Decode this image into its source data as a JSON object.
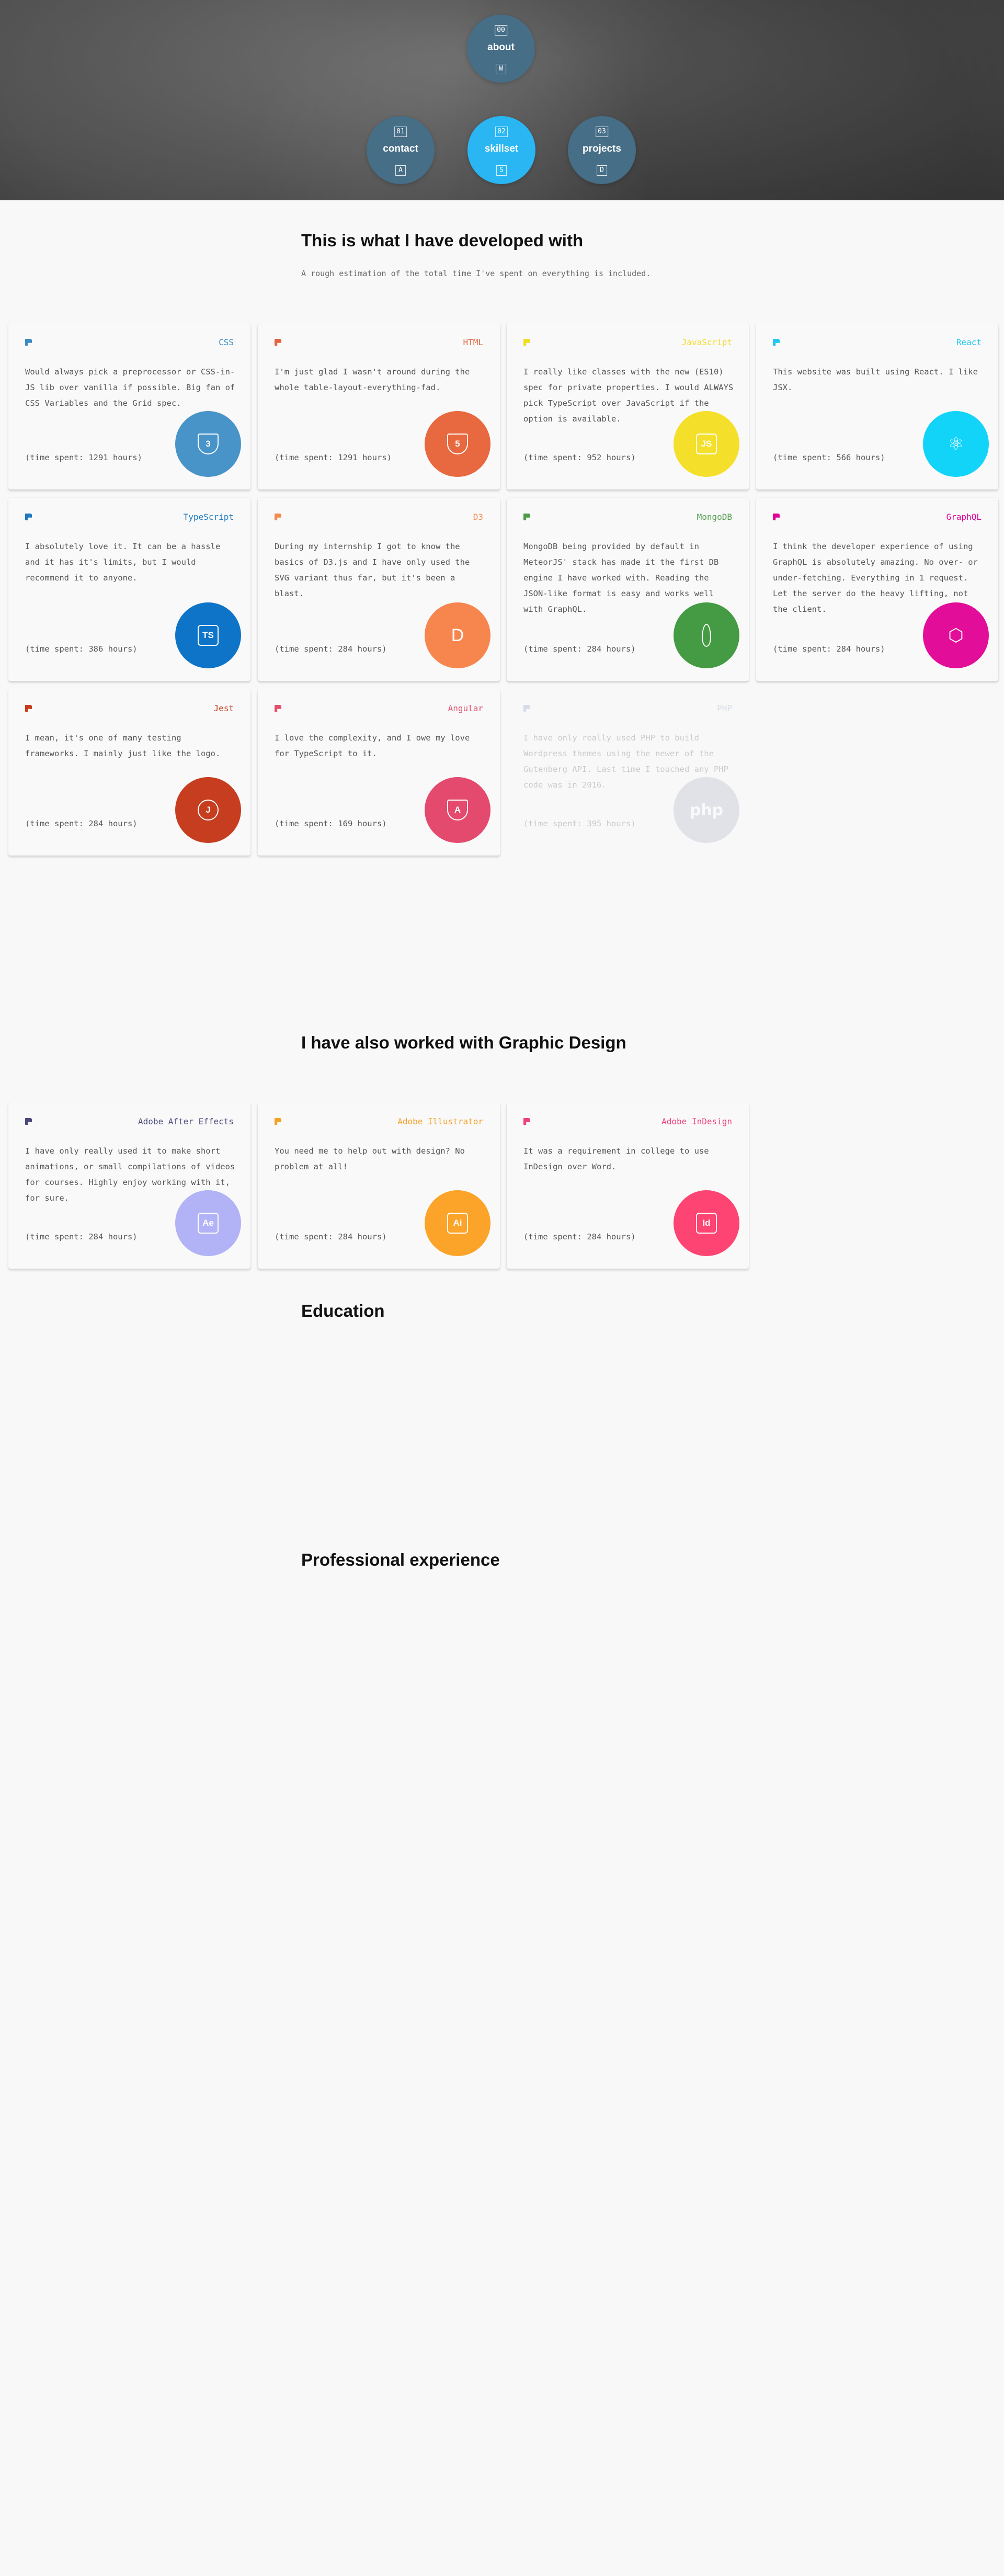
{
  "nav": [
    {
      "num": "00",
      "label": "about",
      "key": "W",
      "active": false
    },
    {
      "num": "01",
      "label": "contact",
      "key": "A",
      "active": false
    },
    {
      "num": "02",
      "label": "skillset",
      "key": "S",
      "active": true
    },
    {
      "num": "03",
      "label": "projects",
      "key": "D",
      "active": false
    }
  ],
  "dev": {
    "title": "This is what I have developed with",
    "subtitle": "A rough estimation of the total time I've spent on everything is included.",
    "cards": [
      {
        "name": "CSS",
        "color": "#3b8cc4",
        "bg": "#4893c8",
        "icon": "css-shield-icon",
        "glyph": "3",
        "shape": "shield",
        "desc": "Would always pick a preprocessor or CSS-in-JS lib over vanilla if possible. Big fan of CSS Variables and the Grid spec.",
        "time": "(time spent: 1291 hours)"
      },
      {
        "name": "HTML",
        "color": "#e4633e",
        "bg": "#e8683f",
        "icon": "html-shield-icon",
        "glyph": "5",
        "shape": "shield",
        "desc": "I'm just glad I wasn't around during the whole table-layout-everything-fad.",
        "time": "(time spent: 1291 hours)"
      },
      {
        "name": "JavaScript",
        "color": "#f1dc27",
        "bg": "#f4e02b",
        "icon": "js-square-icon",
        "glyph": "JS",
        "shape": "square",
        "desc": "I really like classes with the new (ES10) spec for private properties. I would ALWAYS pick TypeScript over JavaScript if the option is available.",
        "time": "(time spent: 952 hours)"
      },
      {
        "name": "React",
        "color": "#1fc8f0",
        "bg": "#12d3f8",
        "icon": "react-atom-icon",
        "glyph": "⚛",
        "shape": "plain",
        "desc": "This website was built using React. I like JSX.",
        "time": "(time spent: 566 hours)"
      },
      {
        "name": "TypeScript",
        "color": "#1f7ac2",
        "bg": "#0d74c8",
        "icon": "ts-square-icon",
        "glyph": "TS",
        "shape": "square",
        "desc": "I absolutely love it. It can be a hassle and it has it's limits, but I would recommend it to anyone.",
        "time": "(time spent: 386 hours)"
      },
      {
        "name": "D3",
        "color": "#f28b4f",
        "bg": "#f7864e",
        "icon": "d3-icon",
        "glyph": "D",
        "shape": "plain",
        "desc": "During my internship I got to know the basics of D3.js and I have only used the SVG variant thus far, but it's been a blast.",
        "time": "(time spent: 284 hours)"
      },
      {
        "name": "MongoDB",
        "color": "#4d9b49",
        "bg": "#459b43",
        "icon": "mongodb-leaf-icon",
        "glyph": "",
        "shape": "leaf",
        "desc": "MongoDB being provided by default in MeteorJS' stack has made it the first DB engine I have worked with. Reading the JSON-like format is easy and works well with GraphQL.",
        "time": "(time spent: 284 hours)"
      },
      {
        "name": "GraphQL",
        "color": "#e10098",
        "bg": "#e20d98",
        "icon": "graphql-icon",
        "glyph": "⬡",
        "shape": "plain",
        "desc": "I think the developer experience of using GraphQL is absolutely amazing. No over- or under-fetching. Everything in 1 request. Let the server do the heavy lifting, not the client.",
        "time": "(time spent: 284 hours)"
      },
      {
        "name": "Jest",
        "color": "#c63d1b",
        "bg": "#c63d1f",
        "icon": "jest-icon",
        "glyph": "J",
        "shape": "round",
        "desc": "I mean, it's one of many testing frameworks. I mainly just like the logo.",
        "time": "(time spent: 284 hours)"
      },
      {
        "name": "Angular",
        "color": "#e2506e",
        "bg": "#e44a6e",
        "icon": "angular-shield-icon",
        "glyph": "A",
        "shape": "shield",
        "desc": "I love the complexity, and I owe my love for TypeScript to it.",
        "time": "(time spent: 169 hours)"
      },
      {
        "name": "PHP",
        "color": "#8892bf",
        "bg": "#a6adc2",
        "icon": "php-icon",
        "glyph": "php",
        "shape": "php",
        "desc": "I have only really used PHP to build Wordpress themes using the newer of the Gutenberg API. Last time I touched any PHP code was in 2016.",
        "time": "(time spent: 395 hours)",
        "faded": true
      }
    ]
  },
  "design": {
    "title": "I have also worked with Graphic Design",
    "cards": [
      {
        "name": "Adobe After Effects",
        "color": "#4b4a7a",
        "bg": "#b2b2f6",
        "icon": "after-effects-icon",
        "glyph": "Ae",
        "shape": "square",
        "desc": "I have only really used it to make short animations, or small compilations of videos for courses. Highly enjoy working with it, for sure.",
        "time": "(time spent: 284 hours)"
      },
      {
        "name": "Adobe Illustrator",
        "color": "#f4a12a",
        "bg": "#fca42a",
        "icon": "illustrator-icon",
        "glyph": "Ai",
        "shape": "square",
        "desc": "You need me to help out with design? No problem at all!",
        "time": "(time spent: 284 hours)"
      },
      {
        "name": "Adobe InDesign",
        "color": "#f1407a",
        "bg": "#fd4472",
        "icon": "indesign-icon",
        "glyph": "Id",
        "shape": "square",
        "desc": "It was a requirement in college to use InDesign over Word.",
        "time": "(time spent: 284 hours)"
      }
    ]
  },
  "education": {
    "title": "Education"
  },
  "experience": {
    "title": "Professional experience"
  }
}
